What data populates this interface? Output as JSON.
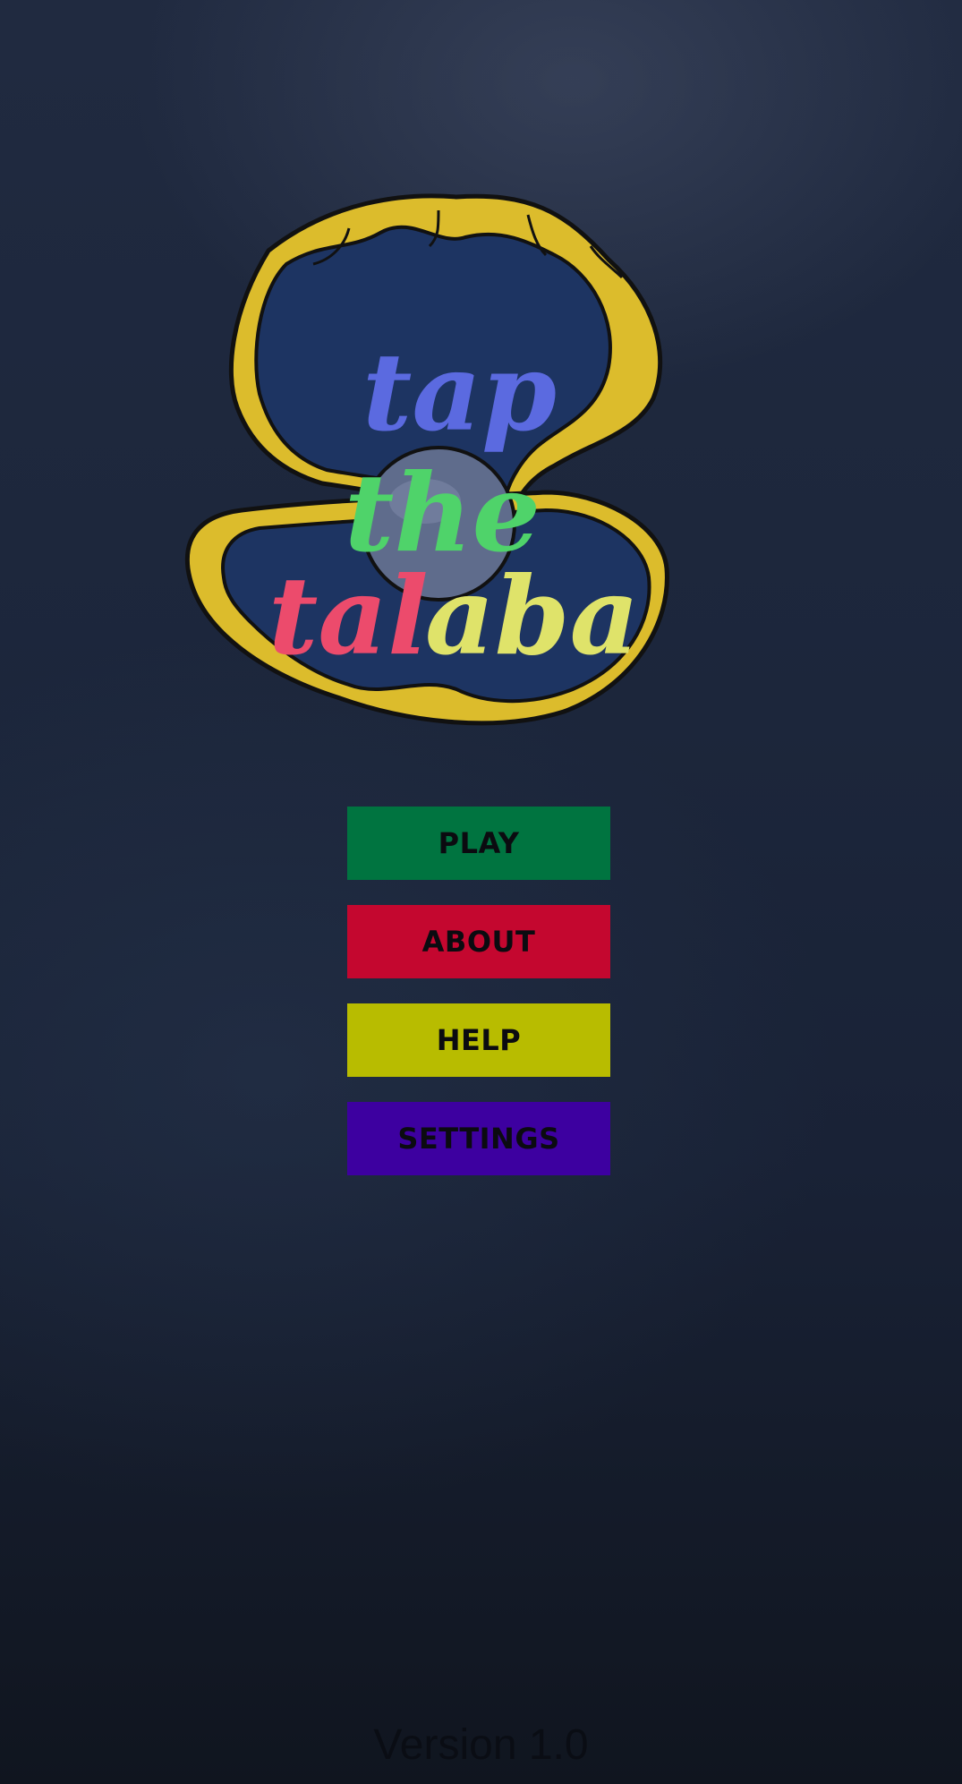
{
  "logo": {
    "word1": "tap",
    "word2": "the",
    "word3a": "tal",
    "word3b": "aba"
  },
  "menu": {
    "play_label": "PLAY",
    "about_label": "ABOUT",
    "help_label": "HELP",
    "settings_label": "SETTINGS"
  },
  "footer": {
    "version": "Version 1.0"
  },
  "colors": {
    "play": "#007440",
    "about": "#c4072f",
    "help": "#b8bc00",
    "settings": "#3d00a0",
    "shell_gold": "#dcbc2c",
    "shell_inner": "#1d3462",
    "pearl": "#5f6c8c",
    "word_tap": "#5b6ae0",
    "word_the": "#4fd36a",
    "word_tal": "#ec4b6c",
    "word_aba": "#dfe36a"
  }
}
